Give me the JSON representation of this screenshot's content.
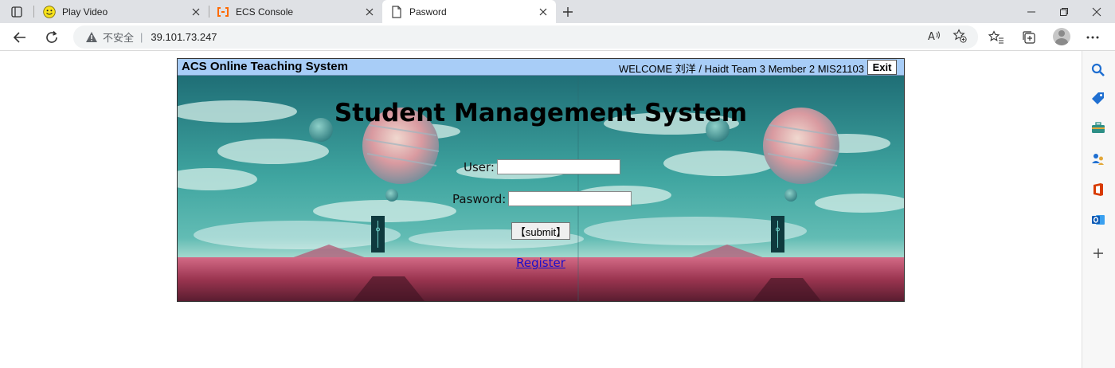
{
  "browser": {
    "tabs": [
      {
        "title": "Play Video",
        "icon": "smiley-icon",
        "active": false
      },
      {
        "title": "ECS Console",
        "icon": "ecs-bracket-icon",
        "active": false
      },
      {
        "title": "Pasword",
        "icon": "page-icon",
        "active": true
      }
    ],
    "address": {
      "security_label": "不安全",
      "separator": "|",
      "url": "39.101.73.247"
    },
    "colors": {
      "tabstrip": "#dfe1e5",
      "active_tab": "#ffffff",
      "omnibox": "#f1f3f4"
    }
  },
  "app": {
    "system_name": "ACS Online Teaching System",
    "welcome_text": "WELCOME 刘洋 / Haidt Team 3 Member 2 MIS21103",
    "exit_label": "Exit",
    "title": "Student Management System",
    "user_label": "User:",
    "user_value": "",
    "password_label": "Pasword:",
    "password_value": "",
    "submit_label": "【submit】",
    "register_label": "Register",
    "colors": {
      "topbar": "#a8cdf7",
      "link": "#1a0dcc"
    }
  },
  "sidebar": {
    "icons": [
      "search-icon",
      "tag-icon",
      "toolbox-icon",
      "people-icon",
      "office-icon",
      "outlook-icon",
      "add-icon"
    ]
  }
}
